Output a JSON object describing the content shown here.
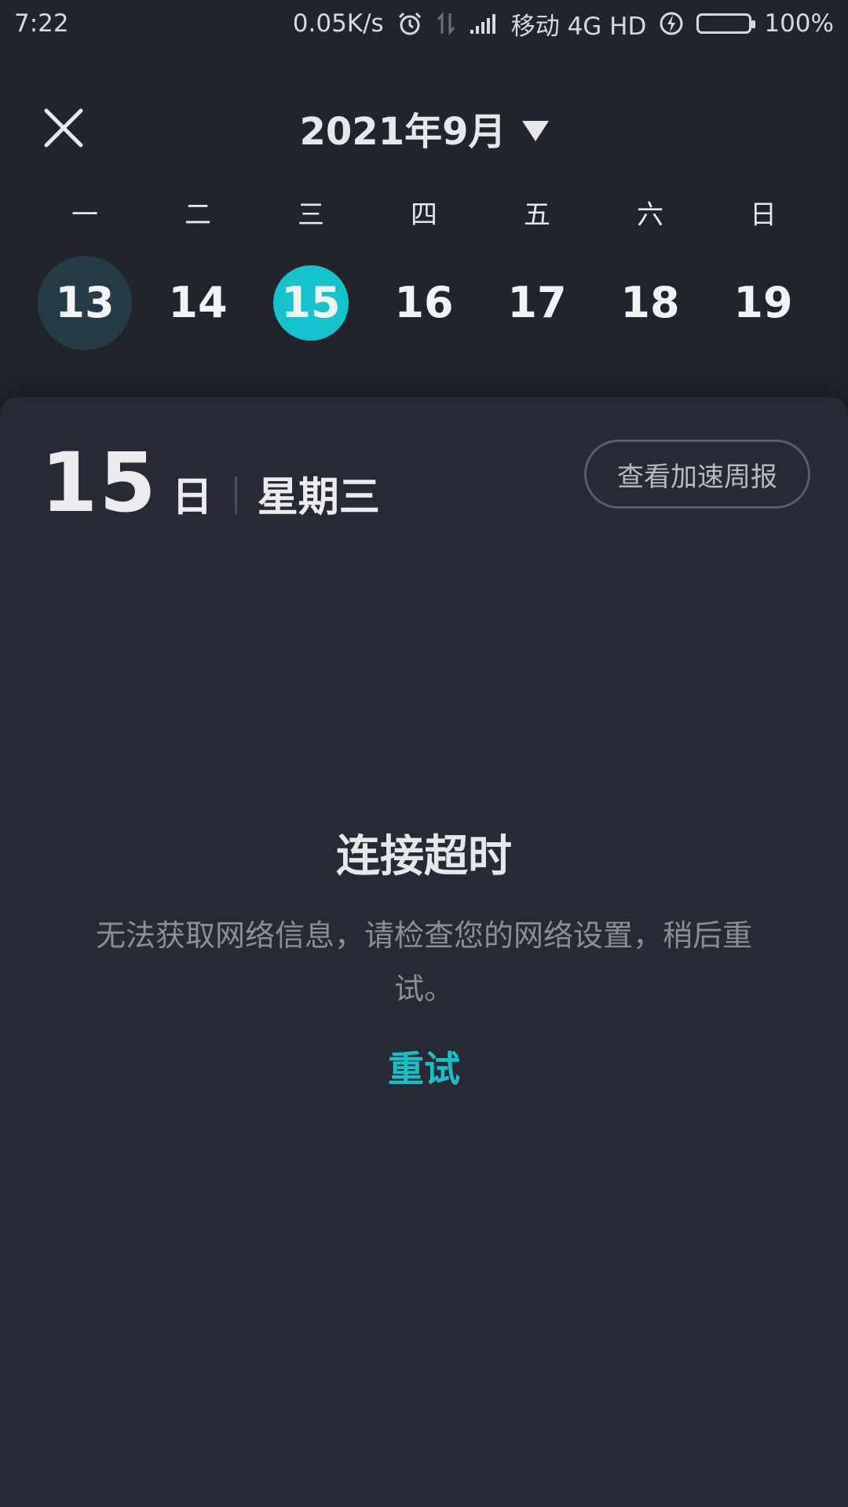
{
  "status_bar": {
    "time": "7:22",
    "net_speed": "0.05K/s",
    "carrier": "移动 4G HD",
    "battery": "100%",
    "icons": [
      "alarm-icon",
      "data-arrows-icon",
      "signal-icon",
      "charging-icon",
      "battery-icon"
    ]
  },
  "header": {
    "month_title": "2021年9月",
    "close_icon": "close-icon",
    "dropdown_icon": "caret-down-icon"
  },
  "week": {
    "labels": [
      "一",
      "二",
      "三",
      "四",
      "五",
      "六",
      "日"
    ],
    "days": [
      "13",
      "14",
      "15",
      "16",
      "17",
      "18",
      "19"
    ],
    "today_index": 0,
    "selected_index": 2
  },
  "card": {
    "day_number": "15",
    "day_unit": "日",
    "weekday": "星期三",
    "weekly_report_button": "查看加速周报"
  },
  "error": {
    "title": "连接超时",
    "description": "无法获取网络信息，请检查您的网络设置，稍后重试。",
    "retry": "重试"
  },
  "colors": {
    "background": "#21242c",
    "card": "#272a34",
    "accent": "#14c3cd",
    "today_circle": "#253b45"
  }
}
